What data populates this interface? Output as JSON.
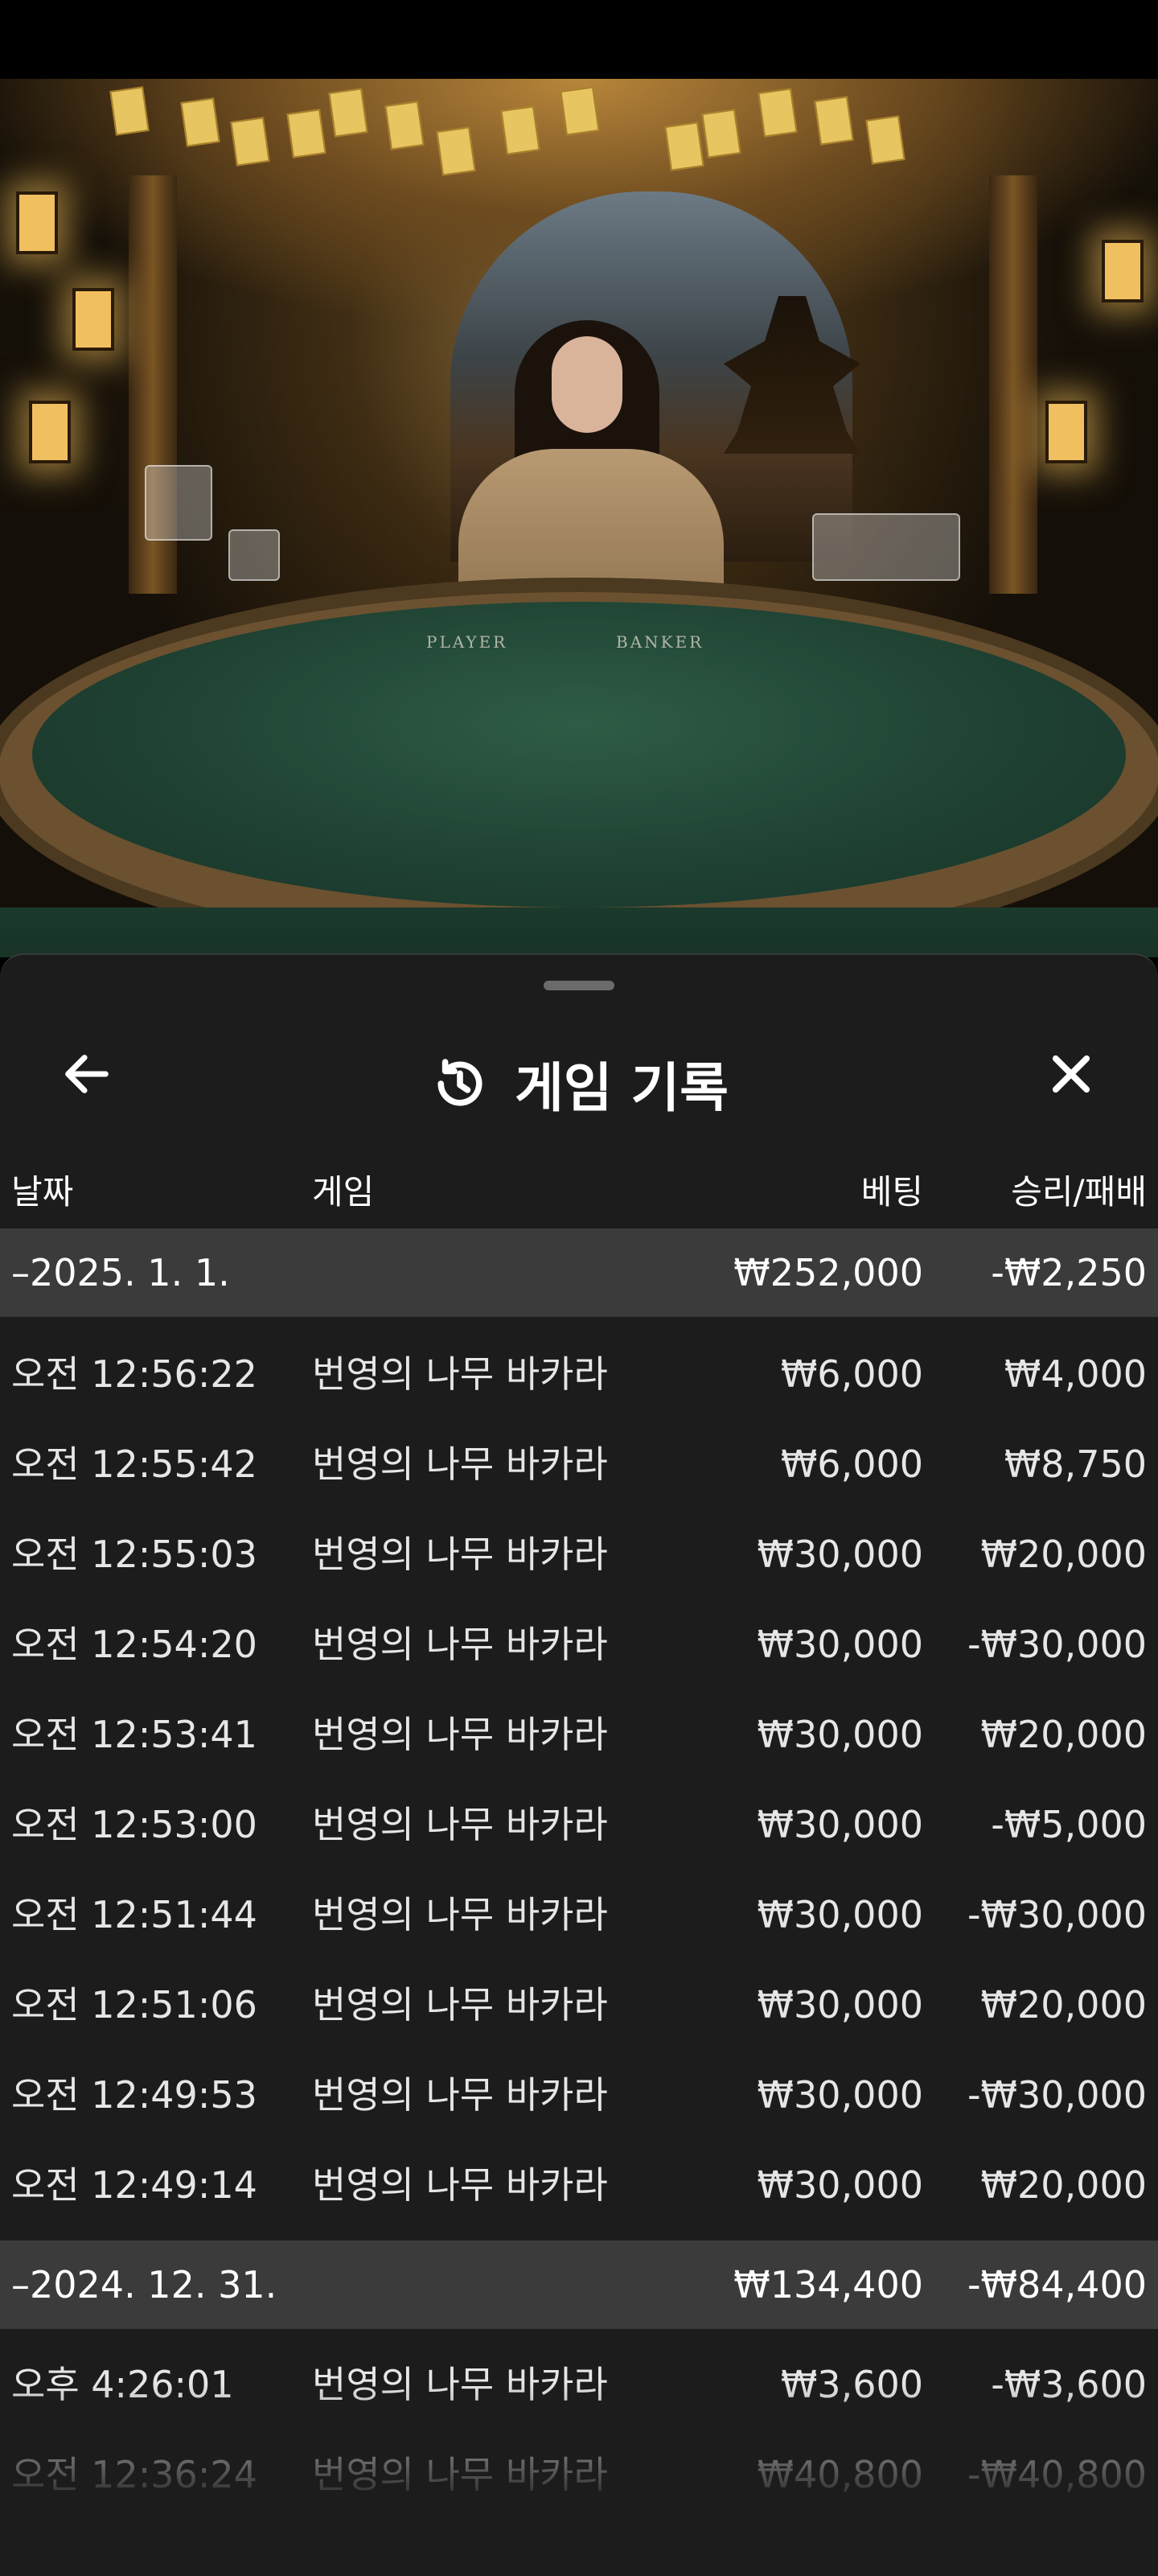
{
  "header": {
    "title": "게임 기록"
  },
  "columns": {
    "date": "날짜",
    "game": "게임",
    "bet": "베팅",
    "win_loss": "승리/패배"
  },
  "table_labels": {
    "player": "PLAYER",
    "banker": "BANKER"
  },
  "groups": [
    {
      "date": "–2025. 1. 1.",
      "total_bet": "₩252,000",
      "total_wl": "-₩2,250",
      "rows": [
        {
          "time": "오전 12:56:22",
          "game": "번영의 나무 바카라",
          "bet": "₩6,000",
          "wl": "₩4,000"
        },
        {
          "time": "오전 12:55:42",
          "game": "번영의 나무 바카라",
          "bet": "₩6,000",
          "wl": "₩8,750"
        },
        {
          "time": "오전 12:55:03",
          "game": "번영의 나무 바카라",
          "bet": "₩30,000",
          "wl": "₩20,000"
        },
        {
          "time": "오전 12:54:20",
          "game": "번영의 나무 바카라",
          "bet": "₩30,000",
          "wl": "-₩30,000"
        },
        {
          "time": "오전 12:53:41",
          "game": "번영의 나무 바카라",
          "bet": "₩30,000",
          "wl": "₩20,000"
        },
        {
          "time": "오전 12:53:00",
          "game": "번영의 나무 바카라",
          "bet": "₩30,000",
          "wl": "-₩5,000"
        },
        {
          "time": "오전 12:51:44",
          "game": "번영의 나무 바카라",
          "bet": "₩30,000",
          "wl": "-₩30,000"
        },
        {
          "time": "오전 12:51:06",
          "game": "번영의 나무 바카라",
          "bet": "₩30,000",
          "wl": "₩20,000"
        },
        {
          "time": "오전 12:49:53",
          "game": "번영의 나무 바카라",
          "bet": "₩30,000",
          "wl": "-₩30,000"
        },
        {
          "time": "오전 12:49:14",
          "game": "번영의 나무 바카라",
          "bet": "₩30,000",
          "wl": "₩20,000"
        }
      ]
    },
    {
      "date": "–2024. 12. 31.",
      "total_bet": "₩134,400",
      "total_wl": "-₩84,400",
      "rows": [
        {
          "time": "오후 4:26:01",
          "game": "번영의 나무 바카라",
          "bet": "₩3,600",
          "wl": "-₩3,600"
        },
        {
          "time": "오전 12:36:24",
          "game": "번영의 나무 바카라",
          "bet": "₩40,800",
          "wl": "-₩40,800"
        }
      ]
    }
  ],
  "icons": {
    "back": "arrow-left-icon",
    "history": "history-clock-icon",
    "close": "close-icon"
  }
}
